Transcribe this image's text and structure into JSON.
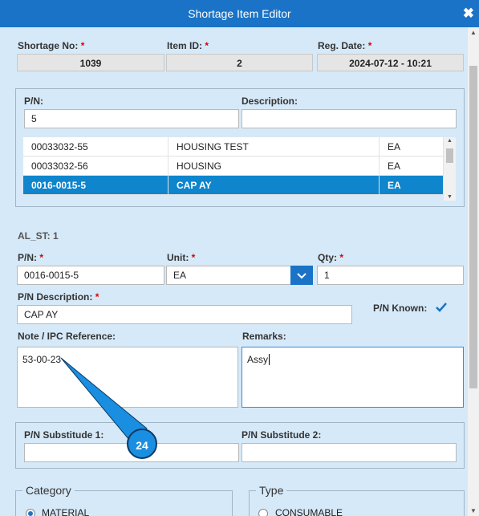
{
  "window": {
    "title": "Shortage Item Editor",
    "close_glyph": "✖"
  },
  "header": {
    "shortage_no": {
      "label": "Shortage No:",
      "value": "1039"
    },
    "item_id": {
      "label": "Item ID:",
      "value": "2"
    },
    "reg_date": {
      "label": "Reg. Date:",
      "value": "2024-07-12 - 10:21"
    },
    "required_mark": "*"
  },
  "search": {
    "pn_label": "P/N:",
    "pn_value": "5",
    "desc_label": "Description:",
    "desc_value": "",
    "results": [
      {
        "pn": "00033032-55",
        "desc": "HOUSING TEST",
        "unit": "EA",
        "selected": false
      },
      {
        "pn": "00033032-56",
        "desc": "HOUSING",
        "unit": "EA",
        "selected": false
      },
      {
        "pn": "0016-0015-5",
        "desc": "CAP AY",
        "unit": "EA",
        "selected": true
      }
    ]
  },
  "section_label": "AL_ST: 1",
  "item": {
    "pn_label": "P/N:",
    "pn_value": "0016-0015-5",
    "unit_label": "Unit:",
    "unit_value": "EA",
    "qty_label": "Qty:",
    "qty_value": "1",
    "pn_desc_label": "P/N Description:",
    "pn_desc_value": "CAP AY",
    "pn_known_label": "P/N Known:",
    "pn_known_checked": true,
    "note_label": "Note / IPC Reference:",
    "note_value": "53-00-23",
    "remarks_label": "Remarks:",
    "remarks_value": "Assy"
  },
  "substitutes": {
    "sub1_label": "P/N Substitude 1:",
    "sub1_value": "",
    "sub2_label": "P/N Substitude 2:",
    "sub2_value": ""
  },
  "category": {
    "legend": "Category",
    "option": "MATERIAL",
    "selected": true
  },
  "type": {
    "legend": "Type",
    "option": "CONSUMABLE",
    "selected": false
  },
  "callout": {
    "number": "24",
    "color": "#1a8ee0"
  },
  "colors": {
    "accent": "#1a73c6",
    "selected_row": "#0e85cc",
    "background": "#d6e9f8"
  }
}
